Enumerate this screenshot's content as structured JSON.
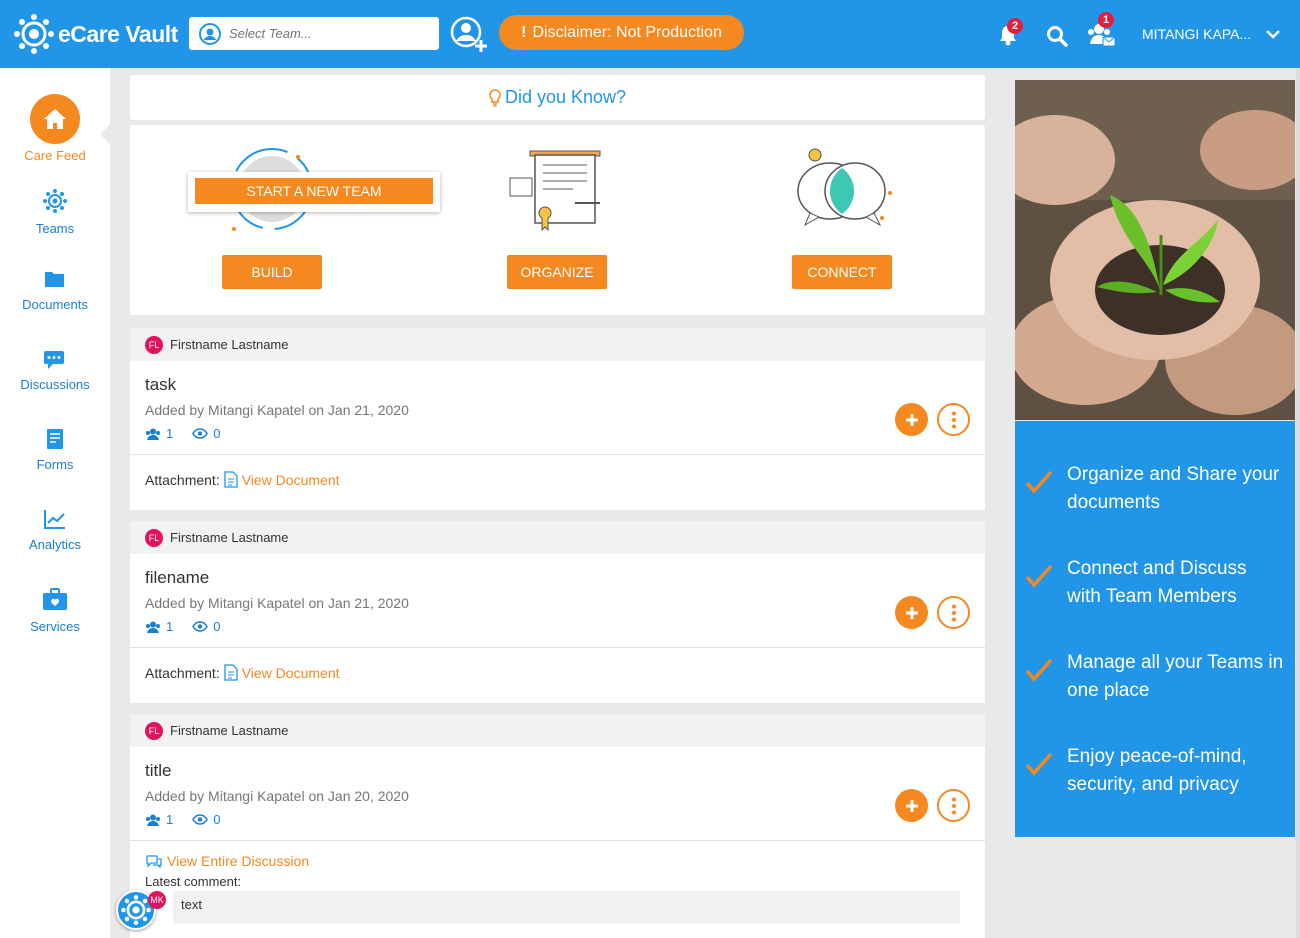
{
  "app": {
    "name": "eCare Vault"
  },
  "header": {
    "team_placeholder": "Select Team...",
    "disclaimer": "Disclaimer: Not Production",
    "notifications_count": "2",
    "invites_count": "1",
    "user_name": "MITANGI KAPA..."
  },
  "sidebar": {
    "items": [
      {
        "label": "Care Feed",
        "icon": "home-icon",
        "active": true
      },
      {
        "label": "Teams",
        "icon": "teams-icon"
      },
      {
        "label": "Documents",
        "icon": "folder-icon"
      },
      {
        "label": "Discussions",
        "icon": "chat-icon"
      },
      {
        "label": "Forms",
        "icon": "form-icon"
      },
      {
        "label": "Analytics",
        "icon": "chart-icon"
      },
      {
        "label": "Services",
        "icon": "briefcase-icon"
      }
    ]
  },
  "did_you_know": "Did you Know?",
  "features": {
    "start_team": "START A NEW TEAM",
    "build": "BUILD",
    "organize": "ORGANIZE",
    "connect": "CONNECT"
  },
  "feed": [
    {
      "initials": "FL",
      "author": "Firstname Lastname",
      "title": "task",
      "added_by": "Added by Mitangi Kapatel",
      "date": "on Jan 21, 2020",
      "members": "1",
      "views": "0",
      "attachment_label": "Attachment:",
      "attachment_link": "View Document"
    },
    {
      "initials": "FL",
      "author": "Firstname Lastname",
      "title": "filename",
      "added_by": "Added by Mitangi Kapatel",
      "date": "on Jan 21, 2020",
      "members": "1",
      "views": "0",
      "attachment_label": "Attachment:",
      "attachment_link": "View Document"
    },
    {
      "initials": "FL",
      "author": "Firstname Lastname",
      "title": "title",
      "added_by": "Added by Mitangi Kapatel",
      "date": "on Jan 20, 2020",
      "members": "1",
      "views": "0",
      "discussion_link": "View Entire Discussion",
      "latest_comment_label": "Latest comment:",
      "comment_initials": "MK",
      "comment_text": "text"
    }
  ],
  "promo": [
    "Organize and Share your documents",
    "Connect and Discuss with Team Members",
    "Manage all your Teams in one place",
    "Enjoy peace-of-mind, security, and privacy"
  ],
  "colors": {
    "primary": "#2196e8",
    "accent": "#f5881f",
    "avatar": "#e3125f"
  }
}
